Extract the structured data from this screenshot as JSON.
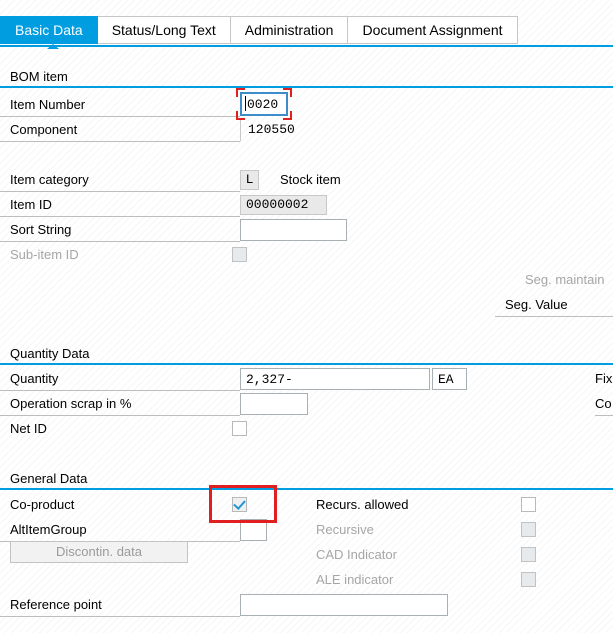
{
  "window": {
    "theme_accent": "#009de0",
    "highlight_color": "#e02020"
  },
  "tabs": [
    {
      "label": "Basic Data",
      "active": true
    },
    {
      "label": "Status/Long Text",
      "active": false
    },
    {
      "label": "Administration",
      "active": false
    },
    {
      "label": "Document Assignment",
      "active": false
    }
  ],
  "sections": {
    "bom_item": {
      "title": "BOM item",
      "fields": {
        "item_number": {
          "label": "Item Number",
          "value": "0020",
          "focused": true,
          "highlighted": true
        },
        "component": {
          "label": "Component",
          "value": "120550",
          "readonly": true
        },
        "item_category": {
          "label": "Item category",
          "value": "L",
          "description": "Stock item",
          "readonly": true
        },
        "item_id": {
          "label": "Item ID",
          "value": "00000002",
          "readonly": true
        },
        "sort_string": {
          "label": "Sort String",
          "value": "",
          "placeholder": ""
        },
        "sub_item_id": {
          "label": "Sub-item ID",
          "checked": false,
          "disabled": true
        },
        "seg_maintained": {
          "label": "Seg. maintain",
          "disabled": true
        },
        "seg_value": {
          "label": "Seg. Value"
        }
      }
    },
    "quantity_data": {
      "title": "Quantity Data",
      "fields": {
        "quantity": {
          "label": "Quantity",
          "value": "2,327-",
          "unit": "EA"
        },
        "fixed_qty": {
          "label": "Fix"
        },
        "operation_scrap": {
          "label": "Operation scrap in %",
          "value": ""
        },
        "co_label": {
          "label": "Co"
        },
        "net_id": {
          "label": "Net ID",
          "checked": false
        }
      }
    },
    "general_data": {
      "title": "General Data",
      "fields": {
        "co_product": {
          "label": "Co-product",
          "checked": true,
          "highlighted": true
        },
        "recurs_allowed": {
          "label": "Recurs. allowed",
          "checked": false,
          "disabled": false
        },
        "alt_item_group": {
          "label": "AltItemGroup",
          "value": ""
        },
        "recursive": {
          "label": "Recursive",
          "checked": false,
          "disabled": true
        },
        "discontin_data": {
          "label": "Discontin. data",
          "disabled": true
        },
        "cad_indicator": {
          "label": "CAD Indicator",
          "checked": false,
          "disabled": true
        },
        "ale_indicator": {
          "label": "ALE indicator",
          "checked": false,
          "disabled": true
        },
        "reference_point": {
          "label": "Reference point",
          "value": ""
        }
      }
    }
  }
}
